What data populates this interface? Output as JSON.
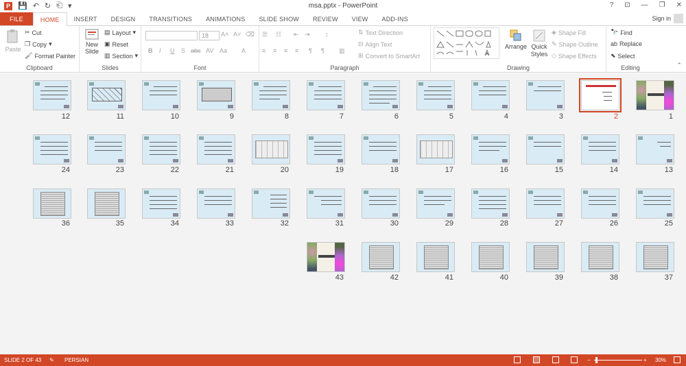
{
  "app": {
    "title": "msa.pptx - PowerPoint"
  },
  "window": {
    "help": "?",
    "restore_ribbon": "⊡",
    "minimize": "—",
    "maximize": "❐",
    "close": "✕"
  },
  "tabs": [
    "FILE",
    "HOME",
    "INSERT",
    "DESIGN",
    "TRANSITIONS",
    "ANIMATIONS",
    "SLIDE SHOW",
    "REVIEW",
    "VIEW",
    "ADD-INS"
  ],
  "signin": "Sign in",
  "clipboard": {
    "label": "Clipboard",
    "paste": "Paste",
    "cut": "Cut",
    "copy": "Copy",
    "format_painter": "Format Painter"
  },
  "slides_grp": {
    "label": "Slides",
    "new_slide": "New",
    "new_slide2": "Slide",
    "layout": "Layout",
    "reset": "Reset",
    "section": "Section"
  },
  "font": {
    "label": "Font",
    "size": "18"
  },
  "paragraph": {
    "label": "Paragraph",
    "text_direction": "Text Direction",
    "align_text": "Align Text",
    "convert_smartart": "Convert to SmartArt"
  },
  "drawing": {
    "label": "Drawing",
    "arrange": "Arrange",
    "quick": "Quick",
    "styles": "Styles",
    "shape_fill": "Shape Fill",
    "shape_outline": "Shape Outline",
    "shape_effects": "Shape Effects"
  },
  "editing": {
    "label": "Editing",
    "find": "Find",
    "replace": "Replace",
    "select": "Select"
  },
  "slide_numbers": [
    "1",
    "2",
    "3",
    "4",
    "5",
    "6",
    "7",
    "8",
    "9",
    "10",
    "11",
    "12",
    "13",
    "14",
    "15",
    "16",
    "17",
    "18",
    "19",
    "20",
    "21",
    "22",
    "23",
    "24",
    "25",
    "26",
    "27",
    "28",
    "29",
    "30",
    "31",
    "32",
    "33",
    "34",
    "35",
    "36",
    "37",
    "38",
    "39",
    "40",
    "41",
    "42",
    "43"
  ],
  "status": {
    "slide": "SLIDE 2 OF 43",
    "language": "PERSIAN",
    "zoom": "30%"
  },
  "colors": {
    "accent": "#d24726",
    "slide_bg": "#d9ebf5"
  }
}
